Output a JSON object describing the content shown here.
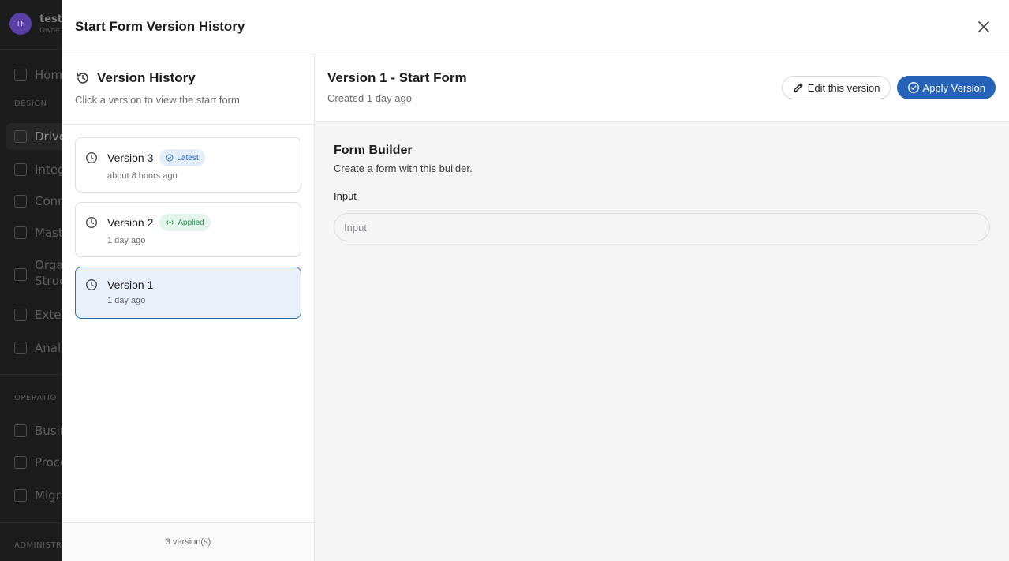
{
  "background_app": {
    "user": {
      "initials": "TF",
      "name": "testi",
      "role": "Owne"
    },
    "sections": {
      "design": "DESIGN",
      "operations": "OPERATIO",
      "admin": "ADMINISTR"
    },
    "items": {
      "home": "Hom",
      "drive": "Drive",
      "integrations": "Integ",
      "connectors": "Conn",
      "master": "Mast",
      "org_line1": "Orga",
      "org_line2": "Struc",
      "external": "Exter",
      "analytics": "Analy",
      "business": "Busin",
      "process": "Proce",
      "migrate": "Migra"
    }
  },
  "modal": {
    "title": "Start Form Version History",
    "left": {
      "title": "Version History",
      "subtitle": "Click a version to view the start form",
      "versions": [
        {
          "name": "Version 3",
          "badge": "Latest",
          "time": "about 8 hours ago"
        },
        {
          "name": "Version 2",
          "badge": "Applied",
          "time": "1 day ago"
        },
        {
          "name": "Version 1",
          "badge": "",
          "time": "1 day ago"
        }
      ],
      "footer": "3 version(s)"
    },
    "right": {
      "title": "Version 1 - Start Form",
      "subtitle": "Created 1 day ago",
      "edit_label": "Edit this version",
      "apply_label": "Apply Version",
      "form": {
        "title": "Form Builder",
        "description": "Create a form with this builder.",
        "field_label": "Input",
        "field_placeholder": "Input"
      }
    }
  },
  "colors": {
    "accent": "#2563b8",
    "latest_badge": "#2a6db8",
    "applied_badge": "#2e8a55",
    "selected_bg": "#e8f0f9"
  }
}
